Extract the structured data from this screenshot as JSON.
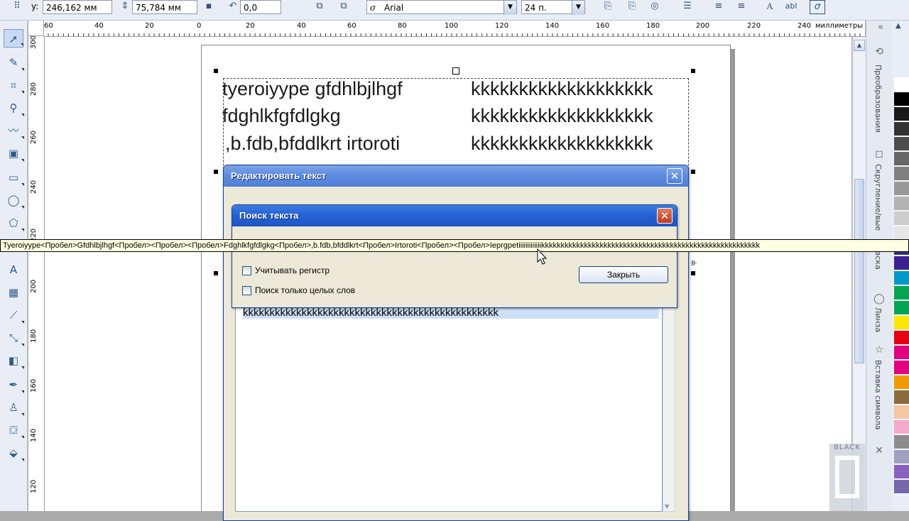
{
  "propbar": {
    "y_label": "y:",
    "x_value": "246,162 мм",
    "height_value": "75,784 мм",
    "rotation_value": "0,0",
    "font_name": "Arial",
    "font_size": "24 п.",
    "font_glyph": "σ",
    "text_icon_a": "A",
    "text_icon_abl": "abl"
  },
  "ruler": {
    "units": "миллиметры",
    "h_ticks": [
      "60",
      "40",
      "20",
      "0",
      "20",
      "40",
      "60",
      "80",
      "100",
      "120",
      "140",
      "160",
      "180",
      "200",
      "220",
      "240"
    ],
    "v_ticks": [
      "300",
      "280",
      "260",
      "240",
      "220",
      "200",
      "180",
      "160",
      "140",
      "120"
    ]
  },
  "canvas": {
    "line1_left": "tyeroiyype gfdhlbjlhgf",
    "line2_left": "fdghlkfgfdlgkg",
    "line3_left": ",b.fdb,bfddlkrt irtoroti",
    "line1_right": "kkkkkkkkkkkkkkkkkkk",
    "line2_right": "kkkkkkkkkkkkkkkkkkk",
    "line3_right": "kkkkkkkkkkkkkkkkkkk"
  },
  "edit_dialog": {
    "title": "Редактировать текст",
    "close": "✕",
    "content_line": "kkkkkkkkkkkkkkkkkkkkkkkkkkkkkkkkkkkkkkkkkkkkkkkk"
  },
  "find_dialog": {
    "title": "Поиск текста",
    "close": "✕",
    "match_case": "Учитывать регистр",
    "whole_words": "Поиск только целых слов",
    "close_button": "Закрыть"
  },
  "tooltip": {
    "text": "Tyeroiyype<Пробел>Gfdhlbjlhgf<Пробел><Пробел><Пробел>Fdghlkfgfdlgkg<Пробел>,b.fdb,bfddlkrt<Пробел>Irtoroti<Пробел><Пробел>Ieprgpetiiiiiiiiiiiiikkkkkkkkkkkkkkkkkkkkkkkkkkkkkkkkkkkkkkkkkkkkkkkkkkkkkkkk"
  },
  "docker": {
    "tab1": "Преобразования",
    "tab2": "Скругление/вые",
    "tab3": "ифаска",
    "tab4": "Линза",
    "tab5": "Вставка символа",
    "close": "✕"
  },
  "watermark": {
    "text": "BLACK"
  },
  "palette_colors": [
    "#ffffff",
    "#000000",
    "#1a1a1a",
    "#333333",
    "#4d4d4d",
    "#666666",
    "#808080",
    "#999999",
    "#b3b3b3",
    "#cccccc",
    "#e6e6e6",
    "#2e2e80",
    "#3b1f8f",
    "#0099cc",
    "#00a651",
    "#00a651",
    "#ffe600",
    "#e60012",
    "#e4007f",
    "#e4007f",
    "#f39800",
    "#8b6b3d",
    "#f7c6a3",
    "#f5a9c8",
    "#8c8c8c",
    "#a0a0c0",
    "#8a5fc0",
    "#7766aa"
  ]
}
